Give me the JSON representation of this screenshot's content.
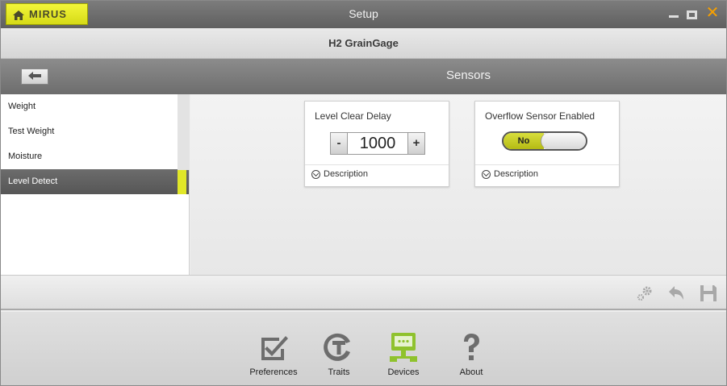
{
  "window": {
    "brand": "MIRUS",
    "title": "Setup",
    "subtitle": "H2 GrainGage"
  },
  "section": {
    "title": "Sensors"
  },
  "sidebar": {
    "items": [
      {
        "label": "Weight"
      },
      {
        "label": "Test Weight"
      },
      {
        "label": "Moisture"
      },
      {
        "label": "Level Detect",
        "active": true
      }
    ]
  },
  "cards": {
    "level_clear_delay": {
      "title": "Level Clear Delay",
      "value": "1000",
      "minus": "-",
      "plus": "+",
      "description": "Description"
    },
    "overflow_sensor": {
      "title": "Overflow Sensor Enabled",
      "state": "No",
      "description": "Description"
    }
  },
  "bottom_nav": [
    {
      "label": "Preferences",
      "icon": "checkbox-edit-icon"
    },
    {
      "label": "Traits",
      "icon": "traits-icon"
    },
    {
      "label": "Devices",
      "icon": "devices-icon"
    },
    {
      "label": "About",
      "icon": "question-icon"
    }
  ],
  "colors": {
    "accent": "#e1e728",
    "devices_icon": "#8fc22d",
    "close": "#f7a000"
  }
}
